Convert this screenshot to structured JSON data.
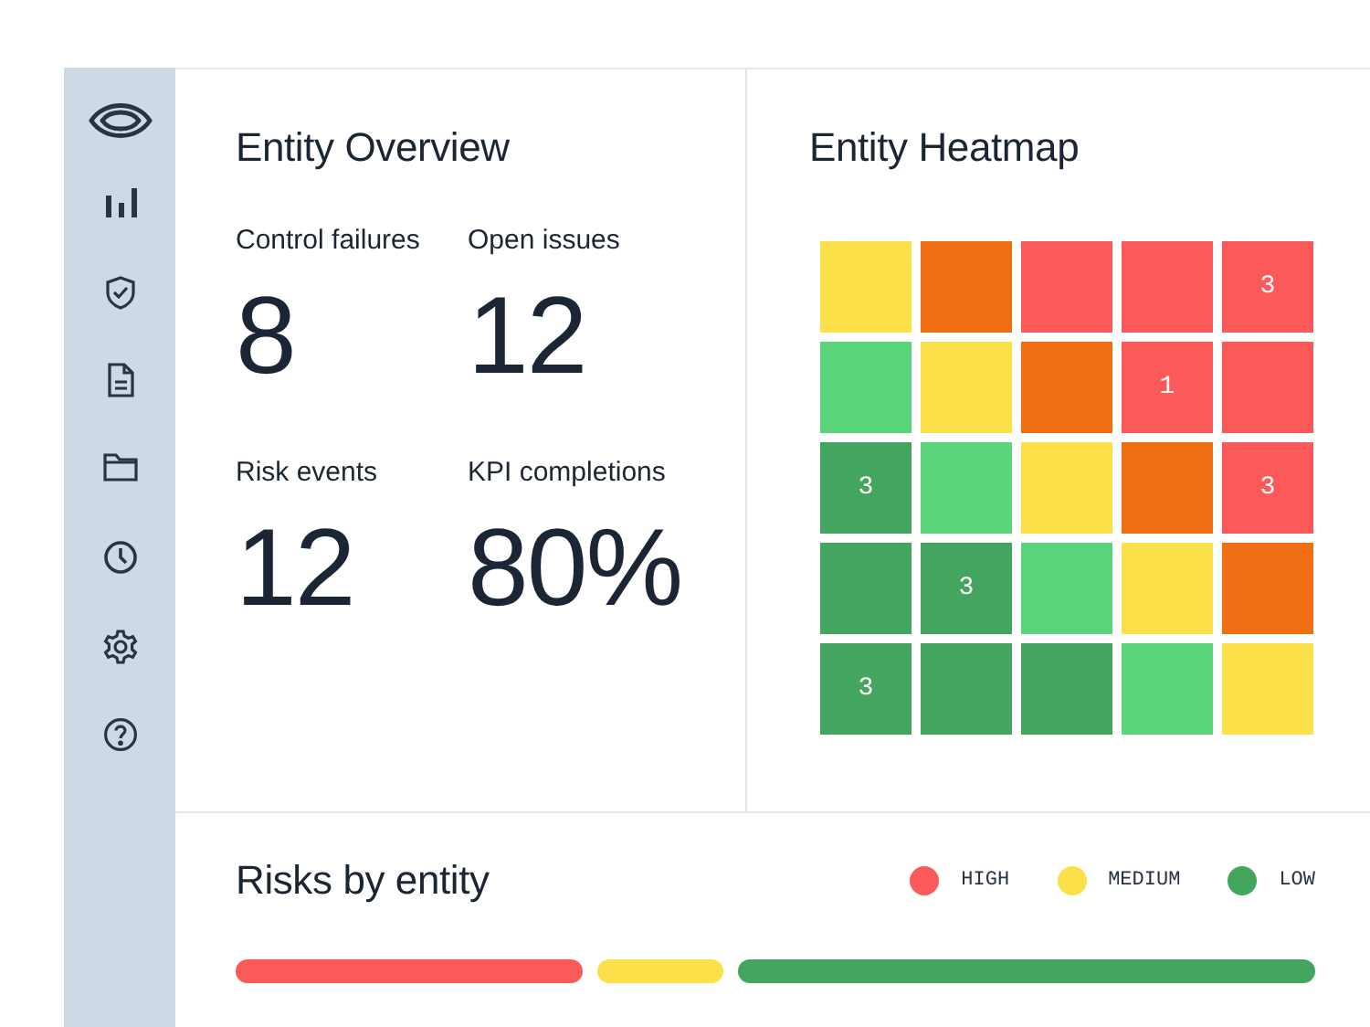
{
  "overview": {
    "title": "Entity Overview",
    "stats": [
      {
        "label": "Control failures",
        "value": "8"
      },
      {
        "label": "Open issues",
        "value": "12"
      },
      {
        "label": "Risk events",
        "value": "12"
      },
      {
        "label": "KPI completions",
        "value": "80%"
      }
    ]
  },
  "heatmap": {
    "title": "Entity Heatmap",
    "rows": [
      [
        {
          "color": "#fbe04a"
        },
        {
          "color": "#ef7012"
        },
        {
          "color": "#fc5a5a"
        },
        {
          "color": "#fc5a5a"
        },
        {
          "color": "#fc5a5a",
          "label": "3"
        }
      ],
      [
        {
          "color": "#5bd57b"
        },
        {
          "color": "#fbe04a"
        },
        {
          "color": "#ef7012"
        },
        {
          "color": "#fc5a5a",
          "label": "1"
        },
        {
          "color": "#fc5a5a"
        }
      ],
      [
        {
          "color": "#43a55e",
          "label": "3"
        },
        {
          "color": "#5bd57b"
        },
        {
          "color": "#fbe04a"
        },
        {
          "color": "#ef7012"
        },
        {
          "color": "#fc5a5a",
          "label": "3"
        }
      ],
      [
        {
          "color": "#43a55e"
        },
        {
          "color": "#43a55e",
          "label": "3"
        },
        {
          "color": "#5bd57b"
        },
        {
          "color": "#fbe04a"
        },
        {
          "color": "#ef7012"
        }
      ],
      [
        {
          "color": "#43a55e",
          "label": "3"
        },
        {
          "color": "#43a55e"
        },
        {
          "color": "#43a55e"
        },
        {
          "color": "#5bd57b"
        },
        {
          "color": "#fbe04a"
        }
      ]
    ]
  },
  "risks": {
    "title": "Risks by entity",
    "legend": [
      {
        "label": "HIGH",
        "color": "#fc5a5a"
      },
      {
        "label": "MEDIUM",
        "color": "#fbe04a"
      },
      {
        "label": "LOW",
        "color": "#43a55e"
      }
    ],
    "segments": [
      {
        "color": "#fc5a5a"
      },
      {
        "color": "#fbe04a"
      },
      {
        "color": "#43a55e"
      }
    ]
  }
}
